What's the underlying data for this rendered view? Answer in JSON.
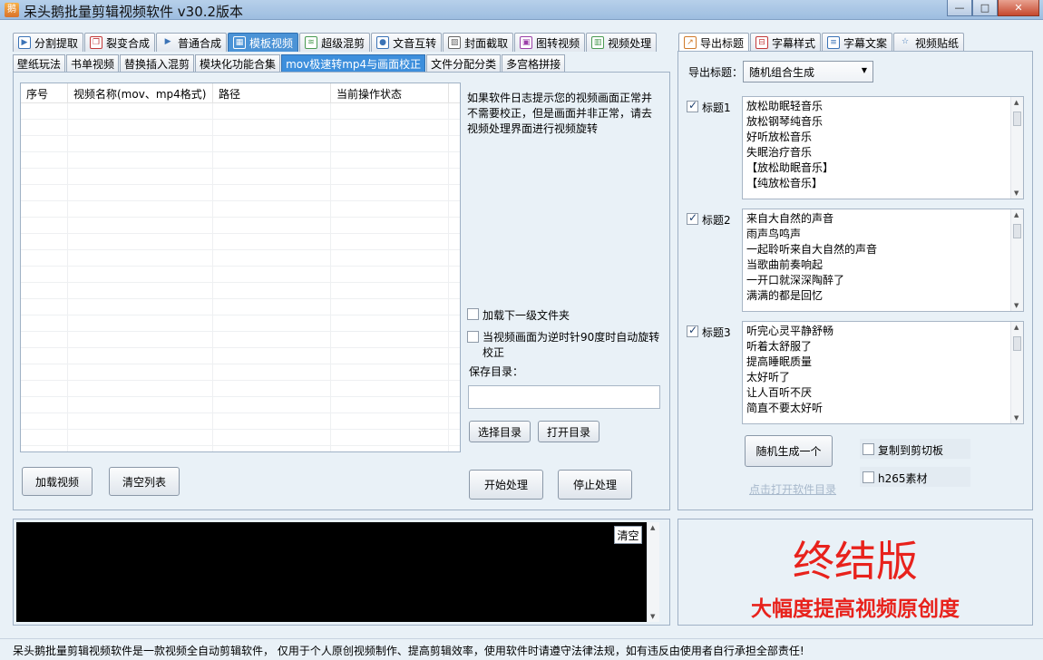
{
  "window": {
    "title": "呆头鹅批量剪辑视频软件   v30.2版本",
    "minimize": "—",
    "maximize": "□",
    "close": "✕"
  },
  "main_tabs": [
    {
      "label": "分割提取",
      "icon": "play-icon"
    },
    {
      "label": "裂变合成",
      "icon": "copy-icon"
    },
    {
      "label": "普通合成",
      "icon": "play-icon"
    },
    {
      "label": "模板视频",
      "icon": "map-icon",
      "active": true
    },
    {
      "label": "超级混剪",
      "icon": "audio-wave-icon"
    },
    {
      "label": "文音互转",
      "icon": "microphone-icon"
    },
    {
      "label": "封面截取",
      "icon": "image-icon"
    },
    {
      "label": "图转视频",
      "icon": "film-icon"
    },
    {
      "label": "视频处理",
      "icon": "video-grid-icon"
    }
  ],
  "sub_tabs": [
    {
      "label": "壁纸玩法"
    },
    {
      "label": "书单视频"
    },
    {
      "label": "替换插入混剪"
    },
    {
      "label": "模块化功能合集"
    },
    {
      "label": "mov极速转mp4与画面校正",
      "active": true
    },
    {
      "label": "文件分配分类"
    },
    {
      "label": "多宫格拼接"
    }
  ],
  "listview": {
    "columns": [
      "序号",
      "视频名称(mov、mp4格式)",
      "路径",
      "当前操作状态"
    ]
  },
  "info_text": "如果软件日志提示您的视频画面正常并不需要校正，但是画面并非正常，请去视频处理界面进行视频旋转",
  "options": {
    "load_subfolder": "加载下一级文件夹",
    "auto_rotate": "当视频画面为逆时针90度时自动旋转校正",
    "save_dir_label": "保存目录："
  },
  "buttons": {
    "choose_dir": "选择目录",
    "open_dir": "打开目录",
    "load_video": "加载视频",
    "clear_list": "清空列表",
    "start": "开始处理",
    "stop": "停止处理",
    "clear_log": "清空"
  },
  "right_tabs": [
    {
      "label": "导出标题",
      "icon": "export-icon",
      "active": true
    },
    {
      "label": "字幕样式",
      "icon": "subtitle-style-icon"
    },
    {
      "label": "字幕文案",
      "icon": "document-icon"
    },
    {
      "label": "视频贴纸",
      "icon": "star-icon"
    }
  ],
  "export": {
    "label": "导出标题：",
    "mode": "随机组合生成",
    "titles": [
      {
        "name": "标题1",
        "checked": true,
        "lines": [
          "放松助眠轻音乐",
          "放松钢琴纯音乐",
          "好听放松音乐",
          "失眠治疗音乐",
          "【放松助眠音乐】",
          "【纯放松音乐】"
        ]
      },
      {
        "name": "标题2",
        "checked": true,
        "lines": [
          "来自大自然的声音",
          "雨声鸟鸣声",
          "一起聆听来自大自然的声音",
          "当歌曲前奏响起",
          "一开口就深深陶醉了",
          "满满的都是回忆"
        ]
      },
      {
        "name": "标题3",
        "checked": true,
        "lines": [
          "听完心灵平静舒畅",
          "听着太舒服了",
          "提高睡眠质量",
          "太好听了",
          "让人百听不厌",
          "简直不要太好听"
        ]
      }
    ],
    "generate_button": "随机生成一个",
    "copy_clipboard": "复制到剪切板",
    "h265": "h265素材",
    "open_dir_link": "点击打开软件目录"
  },
  "promo": {
    "headline": "终结版",
    "subline": "大幅度提高视频原创度"
  },
  "status_bar": "呆头鹅批量剪辑视频软件是一款视频全自动剪辑软件， 仅用于个人原创视频制作、提高剪辑效率，使用软件时请遵守法律法规，如有违反由使用者自行承担全部责任!",
  "colors": {
    "accent": "#4b93d6",
    "promo_red": "#e8221c",
    "log_bg": "#000000",
    "panel_bg": "#e9f1f7"
  }
}
